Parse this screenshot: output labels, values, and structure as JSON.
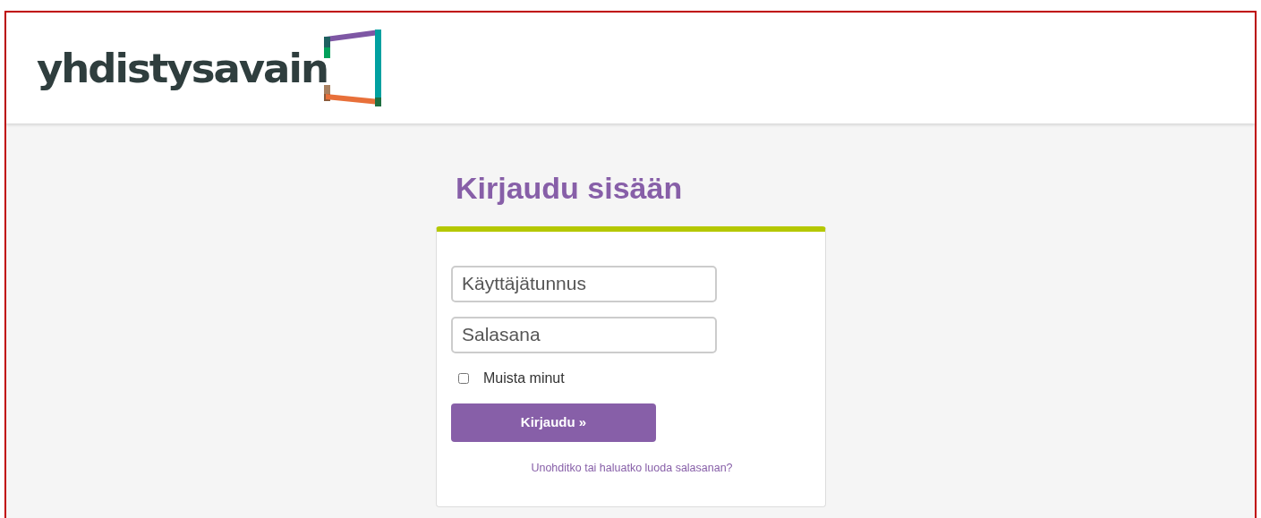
{
  "header": {
    "logo_text": "yhdistysavain"
  },
  "login": {
    "title": "Kirjaudu sisään",
    "username": {
      "placeholder": "Käyttäjätunnus"
    },
    "password": {
      "placeholder": "Salasana"
    },
    "remember": {
      "label": "Muista minut",
      "checked": false
    },
    "submit": "Kirjaudu »",
    "forgot_link": "Unohditko tai haluatko luoda salasanan?"
  }
}
